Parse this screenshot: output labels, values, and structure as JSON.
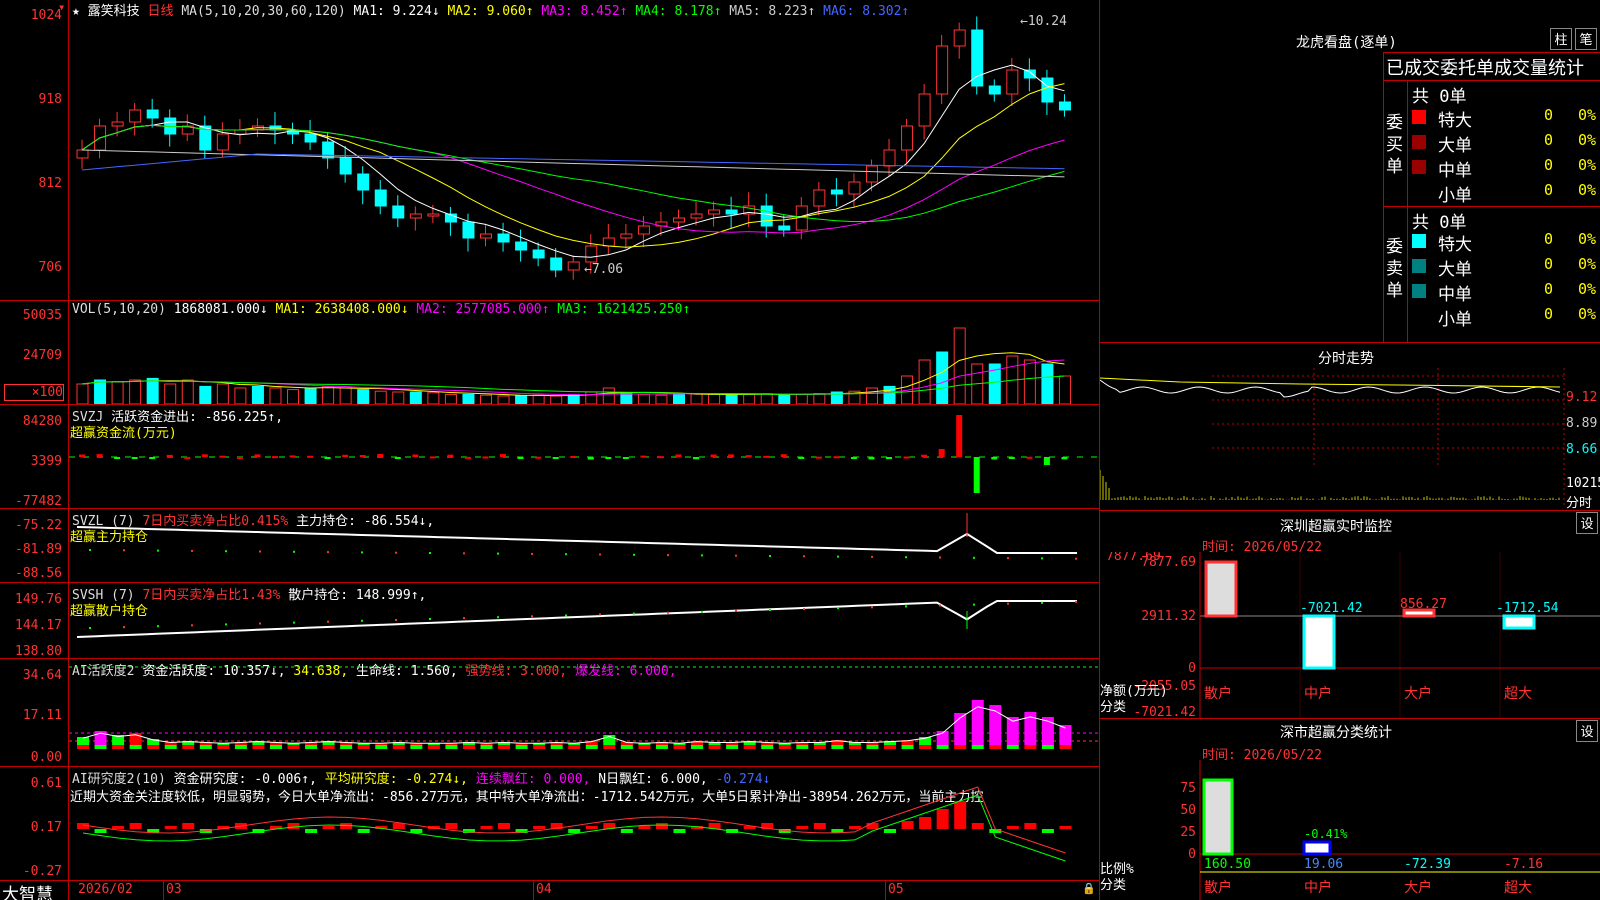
{
  "stock": {
    "name": "露笑科技",
    "period": "日线"
  },
  "main": {
    "ma_label": "MA(5,10,20,30,60,120)",
    "ma1": "MA1: 9.224↓",
    "ma2": "MA2: 9.060↑",
    "ma3": "MA3: 8.452↑",
    "ma4": "MA4: 8.178↑",
    "ma5": "MA5: 8.223↑",
    "ma6": "MA6: 8.302↑",
    "y_ticks": [
      "1024",
      "918",
      "812",
      "706"
    ],
    "high_label": "10.24",
    "low_label": "7.06"
  },
  "vol": {
    "label": "VOL(5,10,20)",
    "value": "1868081.000↓",
    "ma1": "MA1: 2638408.000↓",
    "ma2": "MA2: 2577085.000↑",
    "ma3": "MA3: 1621425.250↑",
    "y_ticks": [
      "50035",
      "24709",
      "×100"
    ]
  },
  "svzj": {
    "label": "SVZJ",
    "text1": "活跃资金进出: -856.225↑,",
    "sub": "超赢资金流(万元)",
    "y_ticks": [
      "84280",
      "3399",
      "-77482"
    ]
  },
  "svzl": {
    "label": "SVZL (7)",
    "text1": "7日内买卖净占比0.415%",
    "text2": "主力持仓: -86.554↓,",
    "sub": "超赢主力持仓",
    "y_ticks": [
      "-75.22",
      "-81.89",
      "-88.56"
    ]
  },
  "svsh": {
    "label": "SVSH (7)",
    "text1": "7日内买卖净占比1.43%",
    "text2": "散户持仓: 148.999↑,",
    "sub": "超赢散户持仓",
    "y_ticks": [
      "149.76",
      "144.17",
      "138.80"
    ]
  },
  "ai1": {
    "label": "AI活跃度2",
    "t1": "资金活跃度: 10.357↓,",
    "t2": "34.638,",
    "t3": "生命线: 1.560,",
    "t4": "强势线: 3.000,",
    "t5": "爆发线: 6.000,",
    "y_ticks": [
      "34.64",
      "17.11",
      "0.00"
    ]
  },
  "ai2": {
    "label": "AI研究度2(10)",
    "t1": "资金研究度: -0.006↑,",
    "t2": "平均研究度: -0.274↓,",
    "t3": "连续飘红: 0.000,",
    "t4": "N日飘红: 6.000,",
    "t5": "-0.274↓",
    "desc": "近期大资金关注度较低，明显弱势，今日大单净流出：-856.27万元，其中特大单净流出：-1712.542万元，大单5日累计净出-38954.262万元，当前主力控",
    "y_ticks": [
      "0.61",
      "0.17",
      "-0.27"
    ]
  },
  "xaxis": {
    "labels": [
      "2026/02",
      "03",
      "04",
      "05"
    ],
    "brand": "大智慧"
  },
  "right": {
    "lhb_title": "龙虎看盘(逐单)",
    "btn1": "柱",
    "btn2": "笔",
    "stats_title": "已成交委托单成交量统计",
    "buy_label": "委买单",
    "sell_label": "委卖单",
    "buy_total": "共 0单",
    "sell_total": "共 0单",
    "rows": [
      {
        "name": "特大",
        "v": "0",
        "p": "0%"
      },
      {
        "name": "大单",
        "v": "0",
        "p": "0%"
      },
      {
        "name": "中单",
        "v": "0",
        "p": "0%"
      },
      {
        "name": "小单",
        "v": "0",
        "p": "0%"
      }
    ],
    "colors": {
      "buy": [
        "#ff0000",
        "#990000",
        "#990000",
        "#000000"
      ],
      "sell": [
        "#00ffff",
        "#008080",
        "#008080",
        "#000000"
      ]
    },
    "intraday_title": "分时走势",
    "intraday_y": [
      "9.12",
      "8.89",
      "8.66",
      "10215",
      "分时"
    ],
    "monitor_title": "深圳超赢实时监控",
    "monitor_btn": "设",
    "monitor_time": "时间: 2026/05/22",
    "monitor_y": [
      "7877.69",
      "2911.32",
      "0",
      "-2055.05",
      "-7021.42"
    ],
    "monitor_vals": [
      "7877.69",
      "-7021.42",
      "856.27",
      "-1712.54"
    ],
    "monitor_yunit": "净额(万元)",
    "monitor_xunit": "分类",
    "cats": [
      "散户",
      "中户",
      "大户",
      "超大"
    ],
    "class_title": "深市超赢分类统计",
    "class_btn": "设",
    "class_time": "时间: 2026/05/22",
    "class_y": [
      "75",
      "50",
      "25",
      "0"
    ],
    "class_vals": [
      "160.50",
      "19.06",
      "-72.39",
      "-7.16"
    ],
    "class_pct": "-0.41%",
    "class_yunit": "比例%",
    "class_xunit": "分类"
  }
}
